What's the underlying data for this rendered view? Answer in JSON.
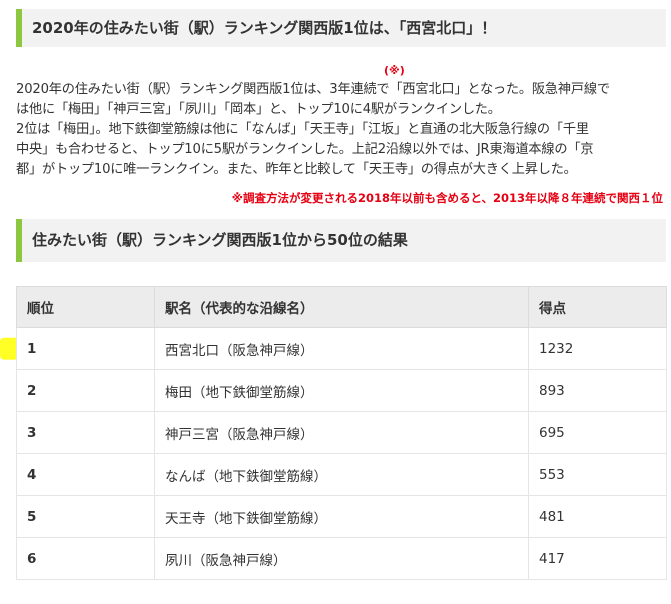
{
  "heading1": "2020年の住みたい街（駅）ランキング関西版1位は、「西宮北口」！",
  "note_mark": "(※)",
  "paragraph_lines": [
    "2020年の住みたい街（駅）ランキング関西版1位は、3年連続で「西宮北口」となった。阪急神戸線で",
    "は他に「梅田」「神戸三宮」「夙川」「岡本」と、トップ10に4駅がランクインした。",
    "2位は「梅田」。地下鉄御堂筋線は他に「なんば」「天王寺」「江坂」と直通の北大阪急行線の「千里",
    "中央」も合わせると、トップ10に5駅がランクインした。上記2沿線以外では、JR東海道本線の「京",
    "都」がトップ10に唯一ランクイン。また、昨年と比較して「天王寺」の得点が大きく上昇した。"
  ],
  "note_line": "※調査方法が変更される2018年以前も含めると、2013年以降８年連続で関西１位",
  "heading2": "住みたい街（駅）ランキング関西版1位から50位の結果",
  "table": {
    "headers": [
      "順位",
      "駅名（代表的な沿線名）",
      "得点"
    ],
    "rows": [
      [
        "1",
        "西宮北口（阪急神戸線）",
        "1232"
      ],
      [
        "2",
        "梅田（地下鉄御堂筋線）",
        "893"
      ],
      [
        "3",
        "神戸三宮（阪急神戸線）",
        "695"
      ],
      [
        "4",
        "なんば（地下鉄御堂筋線）",
        "553"
      ],
      [
        "5",
        "天王寺（地下鉄御堂筋線）",
        "481"
      ],
      [
        "6",
        "夙川（阪急神戸線）",
        "417"
      ]
    ]
  },
  "colors": {
    "accent_border": "#8dc63f",
    "note_red": "#e60012",
    "highlight": "#ffff00"
  }
}
